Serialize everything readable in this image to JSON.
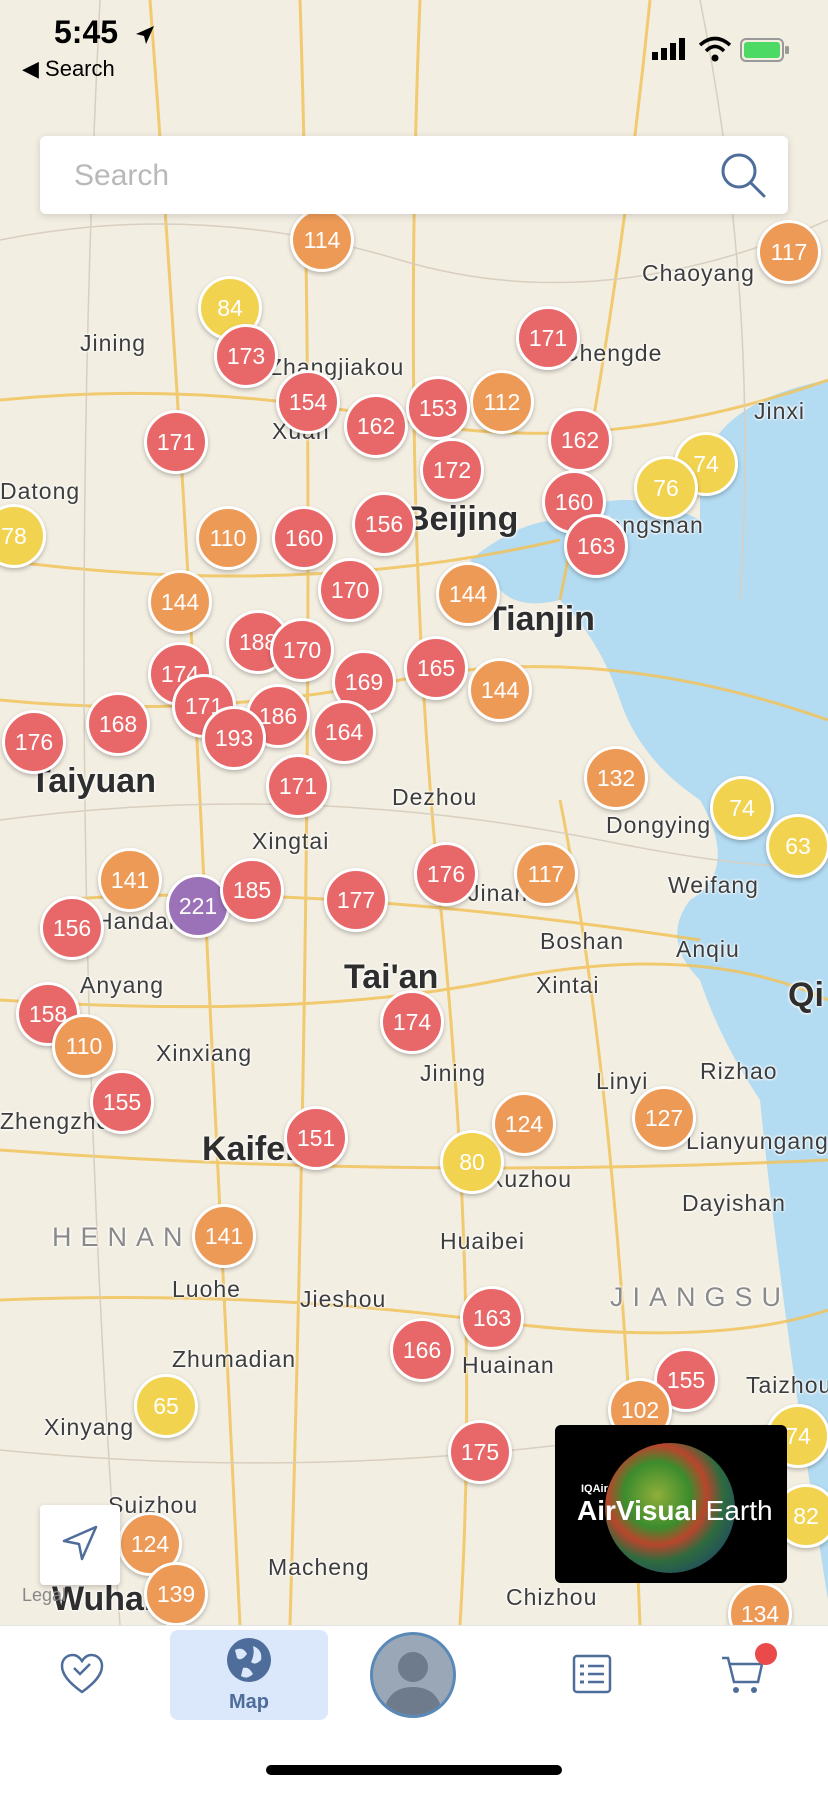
{
  "status_bar": {
    "time": "5:45",
    "back_label": "◀ Search"
  },
  "search": {
    "placeholder": "Search"
  },
  "places": [
    "Jining",
    "Zhangjiakou",
    "Xuan",
    "Chengde",
    "Chaoyang",
    "Jinxi",
    "Datong",
    "Beijing",
    "Tangshan",
    "Tianjin",
    "Taiyuan",
    "Dezhou",
    "Dongying",
    "Weifang",
    "Boshan",
    "Anqiu",
    "Xintai",
    "Tai'an",
    "Anyang",
    "Handan",
    "Xinxiang",
    "Jining",
    "Linyi",
    "Rizhao",
    "Kaifeng",
    "Xuzhou",
    "Lianyungang",
    "Dayishan",
    "Huaibei",
    "Luohe",
    "Jieshou",
    "Zhumadian",
    "Huainan",
    "Xinyang",
    "Suizhou",
    "Macheng",
    "Chizhou",
    "Wuhan",
    "HENAN",
    "JIANGSU",
    "Qi",
    "Zhengzhou",
    "Xingtai",
    "Taizhou",
    "Jinan",
    "Legal"
  ],
  "aqi_markers": [
    {
      "v": "114",
      "c": "orange"
    },
    {
      "v": "117",
      "c": "orange"
    },
    {
      "v": "84",
      "c": "yellow"
    },
    {
      "v": "173",
      "c": "red"
    },
    {
      "v": "171",
      "c": "red"
    },
    {
      "v": "112",
      "c": "orange"
    },
    {
      "v": "154",
      "c": "red"
    },
    {
      "v": "162",
      "c": "red"
    },
    {
      "v": "153",
      "c": "red"
    },
    {
      "v": "171",
      "c": "red"
    },
    {
      "v": "172",
      "c": "red"
    },
    {
      "v": "162",
      "c": "red"
    },
    {
      "v": "74",
      "c": "yellow"
    },
    {
      "v": "76",
      "c": "yellow"
    },
    {
      "v": "160",
      "c": "red"
    },
    {
      "v": "163",
      "c": "red"
    },
    {
      "v": "78",
      "c": "yellow"
    },
    {
      "v": "110",
      "c": "orange"
    },
    {
      "v": "160",
      "c": "red"
    },
    {
      "v": "156",
      "c": "red"
    },
    {
      "v": "144",
      "c": "orange"
    },
    {
      "v": "144",
      "c": "orange"
    },
    {
      "v": "170",
      "c": "red"
    },
    {
      "v": "188",
      "c": "red"
    },
    {
      "v": "170",
      "c": "red"
    },
    {
      "v": "169",
      "c": "red"
    },
    {
      "v": "165",
      "c": "red"
    },
    {
      "v": "176",
      "c": "red"
    },
    {
      "v": "168",
      "c": "red"
    },
    {
      "v": "174",
      "c": "red"
    },
    {
      "v": "171",
      "c": "red"
    },
    {
      "v": "186",
      "c": "red"
    },
    {
      "v": "193",
      "c": "red"
    },
    {
      "v": "164",
      "c": "red"
    },
    {
      "v": "171",
      "c": "red"
    },
    {
      "v": "144",
      "c": "orange"
    },
    {
      "v": "132",
      "c": "orange"
    },
    {
      "v": "74",
      "c": "yellow"
    },
    {
      "v": "63",
      "c": "yellow"
    },
    {
      "v": "141",
      "c": "orange"
    },
    {
      "v": "221",
      "c": "purple"
    },
    {
      "v": "185",
      "c": "red"
    },
    {
      "v": "177",
      "c": "red"
    },
    {
      "v": "176",
      "c": "red"
    },
    {
      "v": "117",
      "c": "orange"
    },
    {
      "v": "156",
      "c": "red"
    },
    {
      "v": "158",
      "c": "red"
    },
    {
      "v": "110",
      "c": "orange"
    },
    {
      "v": "174",
      "c": "red"
    },
    {
      "v": "155",
      "c": "red"
    },
    {
      "v": "151",
      "c": "red"
    },
    {
      "v": "80",
      "c": "yellow"
    },
    {
      "v": "124",
      "c": "orange"
    },
    {
      "v": "127",
      "c": "orange"
    },
    {
      "v": "141",
      "c": "orange"
    },
    {
      "v": "163",
      "c": "red"
    },
    {
      "v": "166",
      "c": "red"
    },
    {
      "v": "155",
      "c": "red"
    },
    {
      "v": "102",
      "c": "orange"
    },
    {
      "v": "65",
      "c": "yellow"
    },
    {
      "v": "175",
      "c": "red"
    },
    {
      "v": "74",
      "c": "yellow"
    },
    {
      "v": "82",
      "c": "yellow"
    },
    {
      "v": "124",
      "c": "orange"
    },
    {
      "v": "139",
      "c": "orange"
    },
    {
      "v": "134",
      "c": "orange"
    }
  ],
  "earth_card": {
    "brand": "IQAir",
    "title_bold": "AirVisual",
    "title_light": "Earth"
  },
  "tabs": [
    {
      "id": "favorites",
      "label": ""
    },
    {
      "id": "map",
      "label": "Map"
    },
    {
      "id": "profile",
      "label": ""
    },
    {
      "id": "news",
      "label": ""
    },
    {
      "id": "shop",
      "label": ""
    }
  ],
  "colors": {
    "red": "#e8686a",
    "orange": "#ee9a57",
    "yellow": "#f2d34f",
    "purple": "#9b72b8",
    "active_tab": "#dbe8fb"
  }
}
